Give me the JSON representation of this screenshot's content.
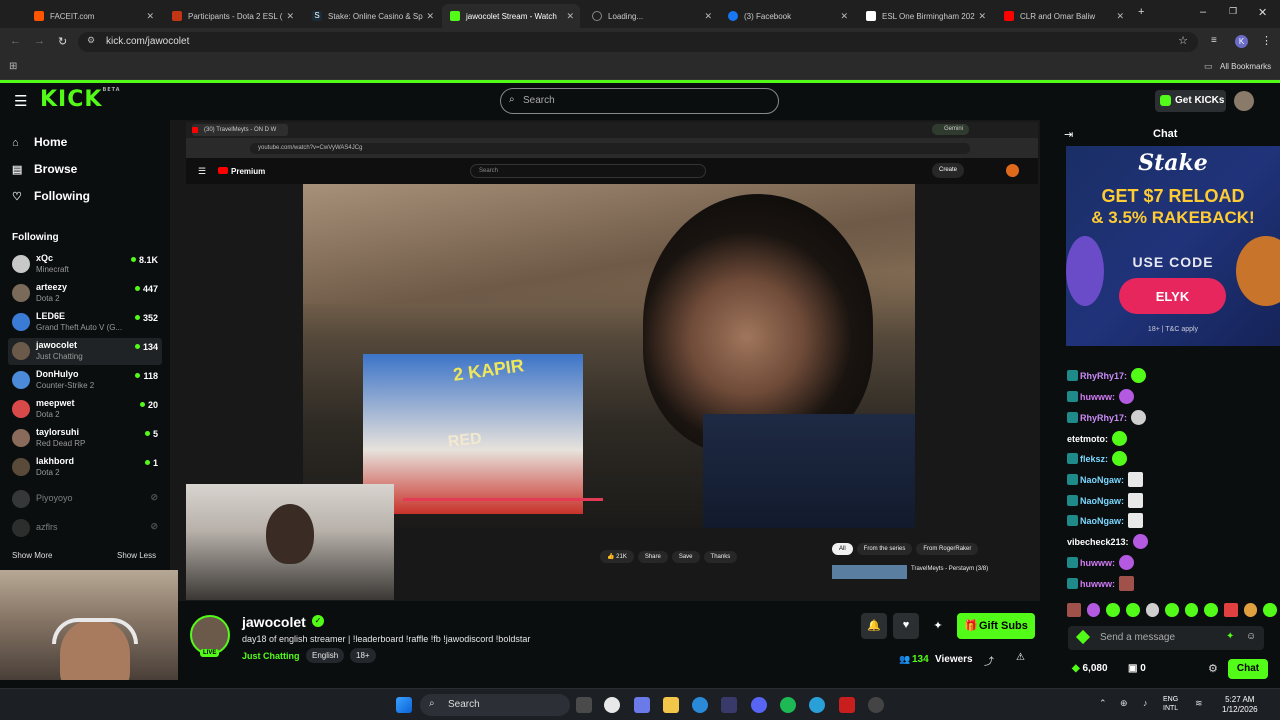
{
  "browser": {
    "tabs": [
      {
        "label": "FACEIT.com",
        "color": "#ff5500"
      },
      {
        "label": "Participants - Dota 2 ESL (",
        "color": "#c23616"
      },
      {
        "label": "Stake: Online Casino & Sp",
        "color": "#1a2c38"
      },
      {
        "label": "jawocolet Stream - Watch",
        "color": "#53fc18"
      },
      {
        "label": "Loading...",
        "color": "#555555"
      },
      {
        "label": "(3) Facebook",
        "color": "#1877f2"
      },
      {
        "label": "ESL One Birmingham 202",
        "color": "#ffffff"
      },
      {
        "label": "CLR and Omar Baliw",
        "color": "#ff0000"
      }
    ],
    "url": "kick.com/jawocolet",
    "profile_initial": "K",
    "all_bookmarks": "All Bookmarks"
  },
  "kick": {
    "logo": "KICK",
    "logo_sup": "BETA",
    "search_placeholder": "Search",
    "get_kicks": "Get KICKs",
    "nav": [
      {
        "label": "Home",
        "icon": "home-icon"
      },
      {
        "label": "Browse",
        "icon": "browse-icon"
      },
      {
        "label": "Following",
        "icon": "heart-icon"
      }
    ],
    "following_heading": "Following",
    "following": [
      {
        "name": "xQc",
        "game": "Minecraft",
        "viewers": "8.1K",
        "color": "#c8c8c8"
      },
      {
        "name": "arteezy",
        "game": "Dota 2",
        "viewers": "447",
        "color": "#7a6a5a"
      },
      {
        "name": "LED6E",
        "game": "Grand Theft Auto V (G...",
        "viewers": "352",
        "color": "#3a7bd5"
      },
      {
        "name": "jawocolet",
        "game": "Just Chatting",
        "viewers": "134",
        "color": "#6b5a4a"
      },
      {
        "name": "DonHulyo",
        "game": "Counter-Strike 2",
        "viewers": "118",
        "color": "#4a8ad8"
      },
      {
        "name": "meepwet",
        "game": "Dota 2",
        "viewers": "20",
        "color": "#d84a4a"
      },
      {
        "name": "taylorsuhi",
        "game": "Red Dead RP",
        "viewers": "5",
        "color": "#8a6a5a"
      },
      {
        "name": "lakhbord",
        "game": "Dota 2",
        "viewers": "1",
        "color": "#5a4a3a"
      }
    ],
    "offline": [
      {
        "name": "Piyoyoyo",
        "color": "#6a6a6a"
      },
      {
        "name": "azflrs",
        "color": "#555555"
      }
    ],
    "show_more": "Show More",
    "show_less": "Show Less"
  },
  "video": {
    "inner_tab": "(30) TravelMeyts - ON D W",
    "inner_gemini": "Gemini",
    "inner_url": "youtube.com/watch?v=CwVyWAS4JCg",
    "yt_premium": "Premium",
    "yt_search": "Search",
    "yt_create": "Create",
    "yt_likes": "21K",
    "yt_share": "Share",
    "yt_save": "Save",
    "yt_thanks": "Thanks",
    "yt_chip_all": "All",
    "yt_chip_series": "From the series",
    "yt_chip_channel": "From RogerRaker",
    "yt_up_next": "TravelMeyts - Perstaym (3/8)",
    "sign_text": "2 KAPIR",
    "red_sign": "RED"
  },
  "stream": {
    "streamer": "jawocolet",
    "title": "day18 of english streamer | !leaderboard !raffle !fb !jawodiscord !boldstar",
    "live": "LIVE",
    "category": "Just Chatting",
    "tags": [
      "English",
      "18+"
    ],
    "gift_subs": "Gift Subs",
    "viewers": "134",
    "viewers_label": "Viewers"
  },
  "chat": {
    "heading": "Chat",
    "ad": {
      "brand": "Stake",
      "headline_1": "GET $7 RELOAD",
      "headline_2": "& 3.5% RAKEBACK!",
      "use_code": "USE CODE",
      "code": "ELYK",
      "disclaimer": "18+ | T&C apply"
    },
    "messages": [
      {
        "user": "RhyRhy17:",
        "color": "#c98cf7",
        "badge": true
      },
      {
        "user": "huwww:",
        "color": "#d17bf5",
        "badge": true
      },
      {
        "user": "RhyRhy17:",
        "color": "#c98cf7",
        "badge": true
      },
      {
        "user": "etetmoto:",
        "color": "#ffffff",
        "badge": false
      },
      {
        "user": "fleksz:",
        "color": "#7ad8ff",
        "badge": true
      },
      {
        "user": "NaoNgaw:",
        "color": "#7ad8ff",
        "badge": true
      },
      {
        "user": "NaoNgaw:",
        "color": "#7ad8ff",
        "badge": true
      },
      {
        "user": "NaoNgaw:",
        "color": "#7ad8ff",
        "badge": true
      },
      {
        "user": "vibecheck213:",
        "color": "#ffffff",
        "badge": false
      },
      {
        "user": "huwww:",
        "color": "#d17bf5",
        "badge": true
      },
      {
        "user": "huwww:",
        "color": "#d17bf5",
        "badge": true
      }
    ],
    "input_placeholder": "Send a message",
    "kicks_balance": "6,080",
    "gift_count": "0",
    "send": "Chat"
  },
  "taskbar": {
    "search": "Search",
    "lang": "ENG",
    "lang_sub": "INTL",
    "time": "5:27 AM",
    "date": "1/12/2026"
  }
}
